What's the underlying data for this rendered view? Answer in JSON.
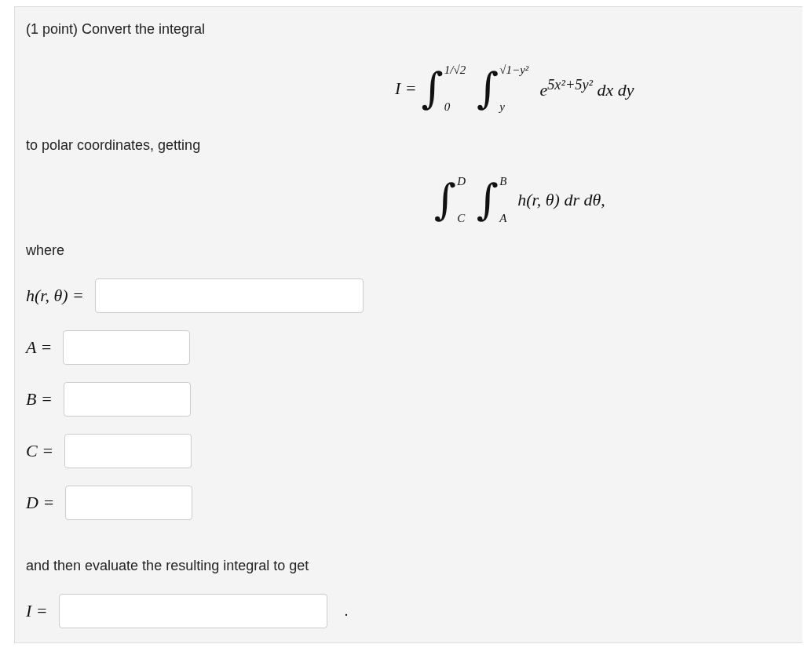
{
  "intro": "(1 point) Convert the integral",
  "formula_1": {
    "lhs": "I =",
    "integrals": [
      {
        "sign": "∫",
        "upper": "1/√2",
        "lower": "0"
      },
      {
        "sign": "∫",
        "upper": "√1−y²",
        "lower": "y"
      }
    ],
    "integrand": "e$^{5x²+5y²}$ dx dy"
  },
  "middle": "to polar coordinates, getting",
  "formula_2": {
    "integrals": [
      {
        "sign": "∫",
        "upper": "D",
        "lower": "C"
      },
      {
        "sign": "∫",
        "upper": "B",
        "lower": "A"
      }
    ],
    "integrand": "h(r, θ) dr dθ,"
  },
  "where": "where",
  "answers": [
    {
      "label": "h(r, θ) =",
      "kind": "wide"
    },
    {
      "label": "A =",
      "kind": "short"
    },
    {
      "label": "B =",
      "kind": "short"
    },
    {
      "label": "C =",
      "kind": "short"
    },
    {
      "label": "D =",
      "kind": "short"
    }
  ],
  "evaluate": "and then evaluate the resulting integral to get",
  "final": {
    "label": "I =",
    "kind": "wide",
    "after": "."
  }
}
